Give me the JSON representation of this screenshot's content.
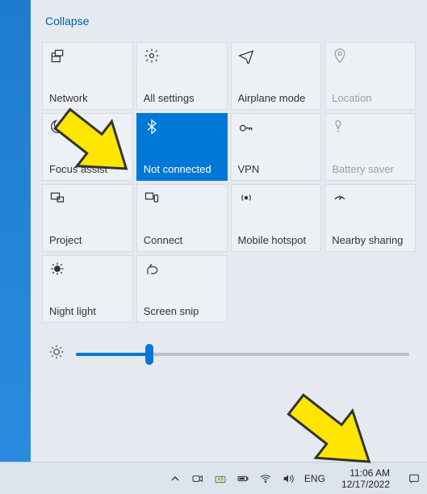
{
  "collapse_label": "Collapse",
  "tiles": [
    {
      "label": "Network",
      "icon": "network",
      "state": "normal"
    },
    {
      "label": "All settings",
      "icon": "settings",
      "state": "normal"
    },
    {
      "label": "Airplane mode",
      "icon": "airplane",
      "state": "normal"
    },
    {
      "label": "Location",
      "icon": "location",
      "state": "disabled"
    },
    {
      "label": "Focus assist",
      "icon": "moon",
      "state": "normal"
    },
    {
      "label": "Not connected",
      "icon": "bluetooth",
      "state": "active"
    },
    {
      "label": "VPN",
      "icon": "vpn",
      "state": "normal"
    },
    {
      "label": "Battery saver",
      "icon": "battery",
      "state": "disabled"
    },
    {
      "label": "Project",
      "icon": "project",
      "state": "normal"
    },
    {
      "label": "Connect",
      "icon": "connect",
      "state": "normal"
    },
    {
      "label": "Mobile hotspot",
      "icon": "hotspot",
      "state": "normal"
    },
    {
      "label": "Nearby sharing",
      "icon": "nearby",
      "state": "normal"
    },
    {
      "label": "Night light",
      "icon": "nightlight",
      "state": "normal"
    },
    {
      "label": "Screen snip",
      "icon": "snip",
      "state": "normal"
    }
  ],
  "brightness": {
    "percent": 22
  },
  "taskbar": {
    "lang": "ENG",
    "time": "11:06 AM",
    "date": "12/17/2022"
  },
  "colors": {
    "accent": "#0078d7",
    "panel": "#e6eaf0",
    "tile": "#edf0f5"
  }
}
